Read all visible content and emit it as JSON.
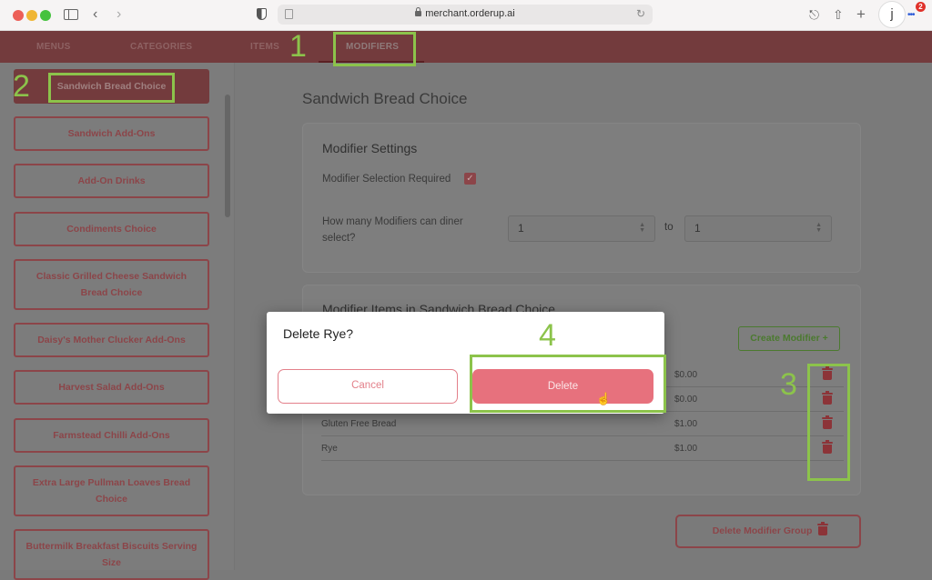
{
  "browser": {
    "url": "merchant.orderup.ai",
    "profile_initial": "j",
    "extension_badge": "2"
  },
  "nav": {
    "tabs": [
      {
        "label": "MENUS"
      },
      {
        "label": "CATEGORIES"
      },
      {
        "label": "ITEMS"
      },
      {
        "label": "MODIFIERS"
      }
    ],
    "active_tab": "MODIFIERS"
  },
  "sidebar": {
    "items": [
      {
        "label": "Sandwich Bread Choice",
        "active": true
      },
      {
        "label": "Sandwich Add-Ons"
      },
      {
        "label": "Add-On Drinks"
      },
      {
        "label": "Condiments Choice"
      },
      {
        "label": "Classic Grilled Cheese Sandwich Bread Choice"
      },
      {
        "label": "Daisy's Mother Clucker Add-Ons"
      },
      {
        "label": "Harvest Salad Add-Ons"
      },
      {
        "label": "Farmstead Chilli Add-Ons"
      },
      {
        "label": "Extra Large Pullman Loaves Bread Choice"
      },
      {
        "label": "Buttermilk Breakfast Biscuits Serving Size"
      }
    ]
  },
  "main": {
    "title": "Sandwich Bread Choice",
    "settings": {
      "heading": "Modifier Settings",
      "required_label": "Modifier Selection Required",
      "required_checked": true,
      "count_label": "How many Modifiers can diner select?",
      "min_value": "1",
      "to_label": "to",
      "max_value": "1"
    },
    "items_card": {
      "heading": "Modifier Items in Sandwich Bread Choice",
      "create_label": "Create Modifier +",
      "rows": [
        {
          "name": "",
          "price": "$0.00"
        },
        {
          "name": "",
          "price": "$0.00"
        },
        {
          "name": "Gluten Free Bread",
          "price": "$1.00"
        },
        {
          "name": "Rye",
          "price": "$1.00"
        }
      ]
    },
    "delete_group_label": "Delete Modifier Group"
  },
  "dialog": {
    "title": "Delete Rye?",
    "cancel_label": "Cancel",
    "confirm_label": "Delete"
  },
  "annotations": [
    "1",
    "2",
    "3",
    "4"
  ],
  "colors": {
    "brand": "#733b3d",
    "accent_red": "#e7717d",
    "annotation_green": "#8cc34b"
  }
}
